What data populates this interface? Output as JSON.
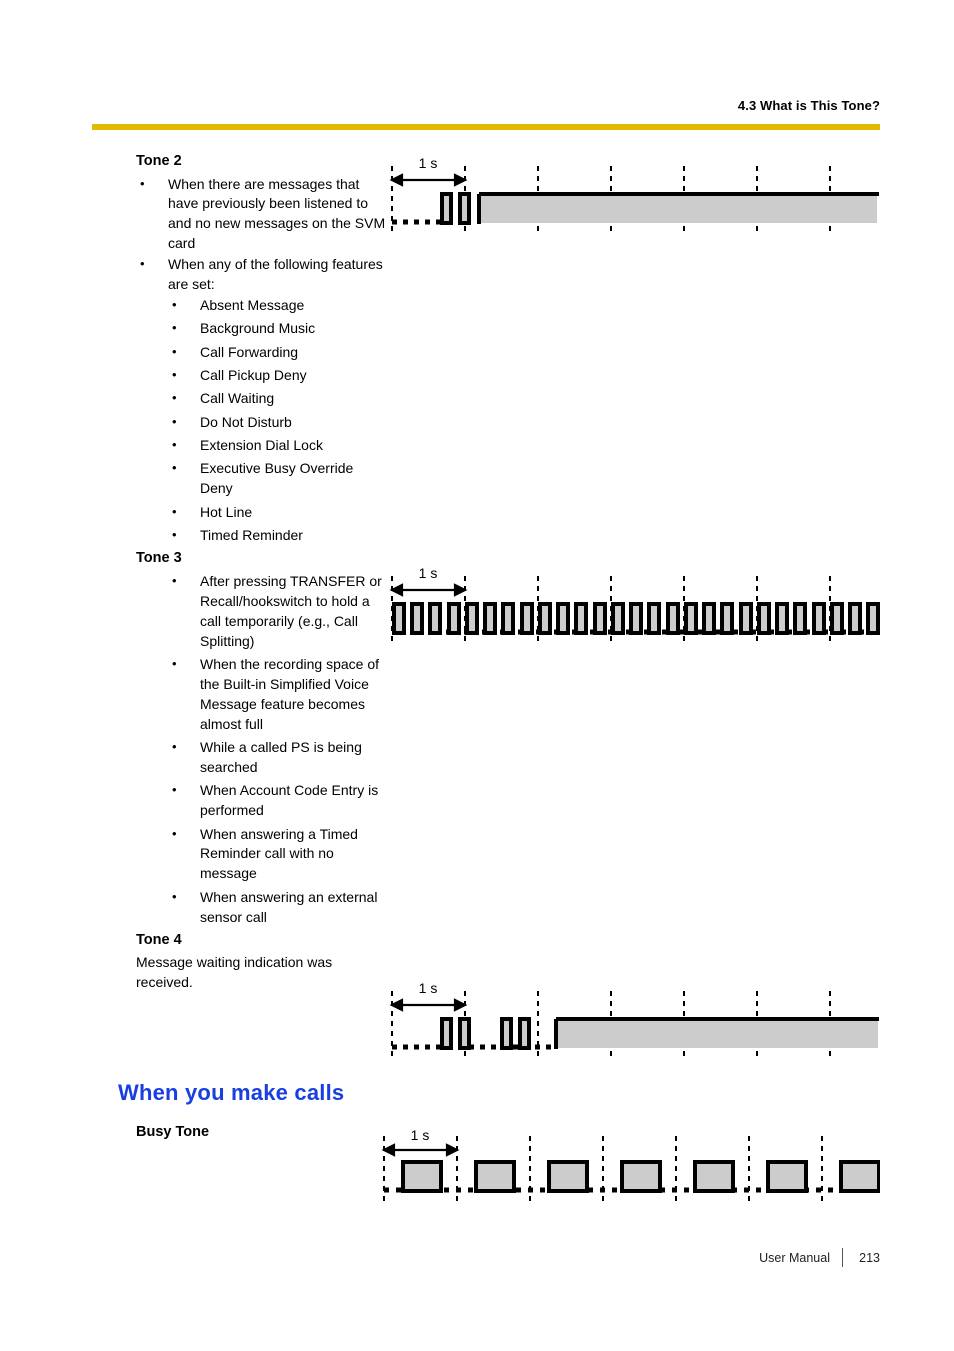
{
  "header": {
    "section_title": "4.3 What is This Tone?",
    "rule_color": "#e3b900"
  },
  "sections": [
    {
      "title": "Tone 2",
      "bullets": [
        "When there are messages that have previously been listened to and no new messages on the SVM card",
        "When any of the following features are set:"
      ],
      "sub_bullets": [
        "Absent Message",
        "Background Music",
        "Call Forwarding",
        "Call Pickup Deny",
        "Call Waiting",
        "Do Not Disturb",
        "Extension Dial Lock",
        "Executive Busy Override Deny",
        "Hot Line",
        "Timed Reminder"
      ]
    },
    {
      "title": "Tone 3",
      "bullets": [
        "After pressing TRANSFER or Recall/hookswitch to hold a call temporarily (e.g., Call Splitting)",
        "When the recording space of the Built-in Simplified Voice Message feature becomes almost full",
        "While a called PS is being searched",
        "When Account Code Entry is performed",
        "When answering a Timed Reminder call with no message",
        "When answering an external sensor call"
      ]
    },
    {
      "title": "Tone 4",
      "paragraph": "Message waiting indication was received."
    }
  ],
  "make_calls": {
    "heading": "When you make calls",
    "heading_color": "#1a3fe0",
    "busy_tone_title": "Busy Tone"
  },
  "diagrams": {
    "scale_label": "1 s",
    "grid_color": "#000000",
    "fill_color": "#cccccc",
    "stroke_color": "#000000",
    "tone2": {
      "name": "tone-2-waveform",
      "description": "two short pulses then continuous tone",
      "seconds_span": 6.4
    },
    "tone3": {
      "name": "tone-3-waveform",
      "description": "continuous repeating short pulse train",
      "seconds_span": 6.4
    },
    "tone4": {
      "name": "tone-4-waveform",
      "description": "two pulse pairs then continuous tone",
      "seconds_span": 6.4
    },
    "busy": {
      "name": "busy-tone-waveform",
      "description": "repeating half-second on, half-second off pulses",
      "seconds_span": 6.4
    }
  },
  "footer": {
    "label": "User Manual",
    "page": "213"
  }
}
